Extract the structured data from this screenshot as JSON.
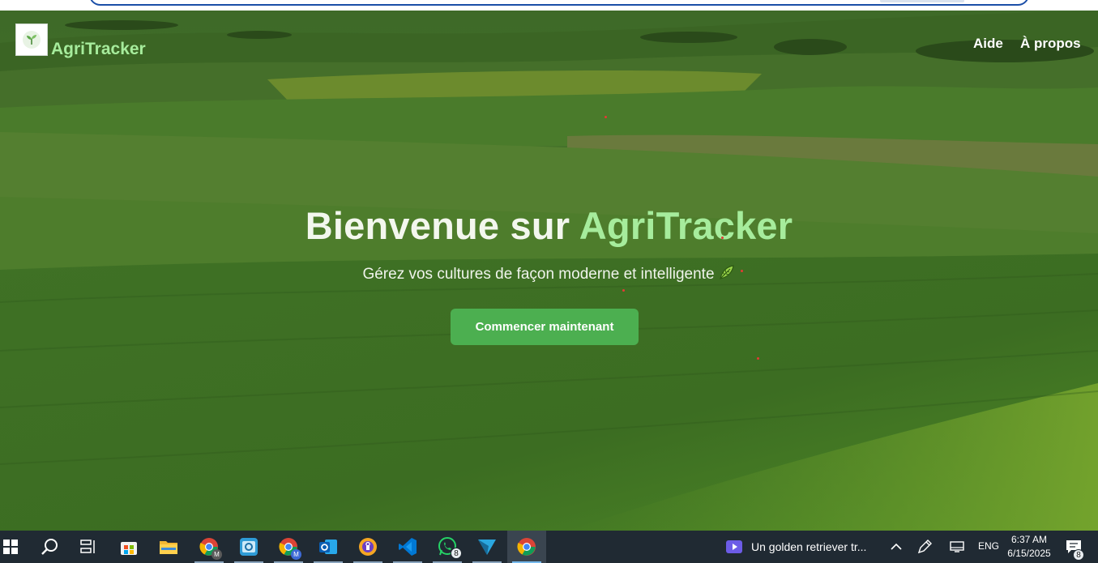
{
  "nav": {
    "brand": "AgriTracker",
    "links": [
      "Aide",
      "À propos"
    ]
  },
  "hero": {
    "title_prefix": "Bienvenue sur ",
    "title_accent": "AgriTracker",
    "subtitle": "Gérez vos cultures de façon moderne et intelligente",
    "cta_label": "Commencer maintenant"
  },
  "colors": {
    "accent": "#a6ec9c",
    "cta": "#4caf50",
    "taskbar": "#202a33"
  },
  "taskbar": {
    "apps": [
      "start-icon",
      "search-icon",
      "task-view-icon",
      "store-icon",
      "file-explorer-icon",
      "chrome-icon",
      "mail-app-icon",
      "chrome-icon",
      "outlook-icon",
      "vpn-icon",
      "vscode-icon",
      "whatsapp-icon",
      "paper-plane-icon",
      "chrome-icon"
    ],
    "whatsapp_badge": "8",
    "chrome_profile_letter": "M",
    "news_text": "Un golden retriever tr...",
    "language": "ENG",
    "time": "6:37 AM",
    "date": "6/15/2025",
    "notification_count": "8"
  }
}
